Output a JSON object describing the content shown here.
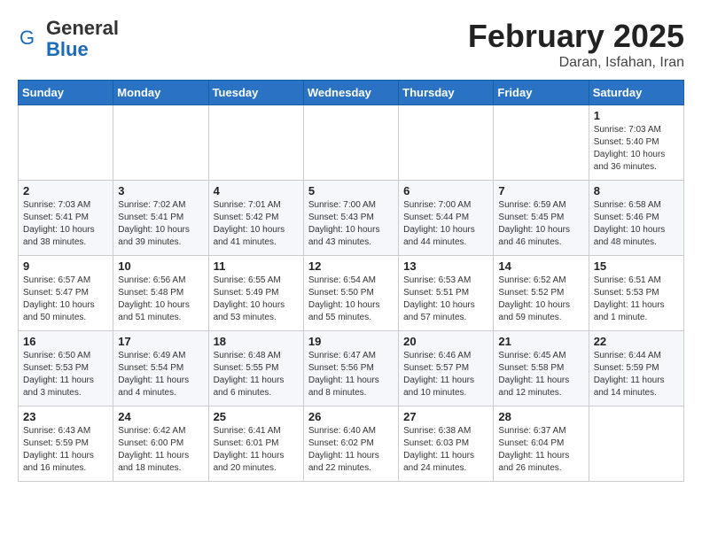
{
  "header": {
    "logo_general": "General",
    "logo_blue": "Blue",
    "month_title": "February 2025",
    "subtitle": "Daran, Isfahan, Iran"
  },
  "weekdays": [
    "Sunday",
    "Monday",
    "Tuesday",
    "Wednesday",
    "Thursday",
    "Friday",
    "Saturday"
  ],
  "weeks": [
    [
      {
        "day": "",
        "info": ""
      },
      {
        "day": "",
        "info": ""
      },
      {
        "day": "",
        "info": ""
      },
      {
        "day": "",
        "info": ""
      },
      {
        "day": "",
        "info": ""
      },
      {
        "day": "",
        "info": ""
      },
      {
        "day": "1",
        "info": "Sunrise: 7:03 AM\nSunset: 5:40 PM\nDaylight: 10 hours and 36 minutes."
      }
    ],
    [
      {
        "day": "2",
        "info": "Sunrise: 7:03 AM\nSunset: 5:41 PM\nDaylight: 10 hours and 38 minutes."
      },
      {
        "day": "3",
        "info": "Sunrise: 7:02 AM\nSunset: 5:41 PM\nDaylight: 10 hours and 39 minutes."
      },
      {
        "day": "4",
        "info": "Sunrise: 7:01 AM\nSunset: 5:42 PM\nDaylight: 10 hours and 41 minutes."
      },
      {
        "day": "5",
        "info": "Sunrise: 7:00 AM\nSunset: 5:43 PM\nDaylight: 10 hours and 43 minutes."
      },
      {
        "day": "6",
        "info": "Sunrise: 7:00 AM\nSunset: 5:44 PM\nDaylight: 10 hours and 44 minutes."
      },
      {
        "day": "7",
        "info": "Sunrise: 6:59 AM\nSunset: 5:45 PM\nDaylight: 10 hours and 46 minutes."
      },
      {
        "day": "8",
        "info": "Sunrise: 6:58 AM\nSunset: 5:46 PM\nDaylight: 10 hours and 48 minutes."
      }
    ],
    [
      {
        "day": "9",
        "info": "Sunrise: 6:57 AM\nSunset: 5:47 PM\nDaylight: 10 hours and 50 minutes."
      },
      {
        "day": "10",
        "info": "Sunrise: 6:56 AM\nSunset: 5:48 PM\nDaylight: 10 hours and 51 minutes."
      },
      {
        "day": "11",
        "info": "Sunrise: 6:55 AM\nSunset: 5:49 PM\nDaylight: 10 hours and 53 minutes."
      },
      {
        "day": "12",
        "info": "Sunrise: 6:54 AM\nSunset: 5:50 PM\nDaylight: 10 hours and 55 minutes."
      },
      {
        "day": "13",
        "info": "Sunrise: 6:53 AM\nSunset: 5:51 PM\nDaylight: 10 hours and 57 minutes."
      },
      {
        "day": "14",
        "info": "Sunrise: 6:52 AM\nSunset: 5:52 PM\nDaylight: 10 hours and 59 minutes."
      },
      {
        "day": "15",
        "info": "Sunrise: 6:51 AM\nSunset: 5:53 PM\nDaylight: 11 hours and 1 minute."
      }
    ],
    [
      {
        "day": "16",
        "info": "Sunrise: 6:50 AM\nSunset: 5:53 PM\nDaylight: 11 hours and 3 minutes."
      },
      {
        "day": "17",
        "info": "Sunrise: 6:49 AM\nSunset: 5:54 PM\nDaylight: 11 hours and 4 minutes."
      },
      {
        "day": "18",
        "info": "Sunrise: 6:48 AM\nSunset: 5:55 PM\nDaylight: 11 hours and 6 minutes."
      },
      {
        "day": "19",
        "info": "Sunrise: 6:47 AM\nSunset: 5:56 PM\nDaylight: 11 hours and 8 minutes."
      },
      {
        "day": "20",
        "info": "Sunrise: 6:46 AM\nSunset: 5:57 PM\nDaylight: 11 hours and 10 minutes."
      },
      {
        "day": "21",
        "info": "Sunrise: 6:45 AM\nSunset: 5:58 PM\nDaylight: 11 hours and 12 minutes."
      },
      {
        "day": "22",
        "info": "Sunrise: 6:44 AM\nSunset: 5:59 PM\nDaylight: 11 hours and 14 minutes."
      }
    ],
    [
      {
        "day": "23",
        "info": "Sunrise: 6:43 AM\nSunset: 5:59 PM\nDaylight: 11 hours and 16 minutes."
      },
      {
        "day": "24",
        "info": "Sunrise: 6:42 AM\nSunset: 6:00 PM\nDaylight: 11 hours and 18 minutes."
      },
      {
        "day": "25",
        "info": "Sunrise: 6:41 AM\nSunset: 6:01 PM\nDaylight: 11 hours and 20 minutes."
      },
      {
        "day": "26",
        "info": "Sunrise: 6:40 AM\nSunset: 6:02 PM\nDaylight: 11 hours and 22 minutes."
      },
      {
        "day": "27",
        "info": "Sunrise: 6:38 AM\nSunset: 6:03 PM\nDaylight: 11 hours and 24 minutes."
      },
      {
        "day": "28",
        "info": "Sunrise: 6:37 AM\nSunset: 6:04 PM\nDaylight: 11 hours and 26 minutes."
      },
      {
        "day": "",
        "info": ""
      }
    ]
  ]
}
